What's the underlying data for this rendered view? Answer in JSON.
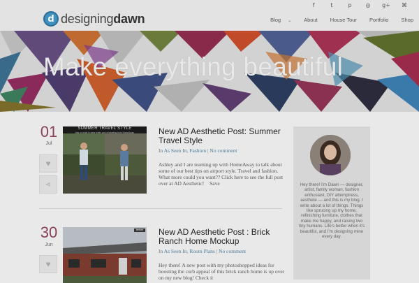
{
  "header": {
    "logo_mark": "d",
    "logo_light": "designing",
    "logo_bold": "dawn",
    "social_icons": [
      "facebook-icon",
      "twitter-icon",
      "pinterest-icon",
      "instagram-icon",
      "google-plus-icon",
      "rss-icon"
    ],
    "social_glyphs": [
      "f",
      "t",
      "p",
      "◎",
      "g+",
      "⌘"
    ],
    "nav": [
      {
        "label": "Blog",
        "has_dropdown": true
      },
      {
        "label": "About"
      },
      {
        "label": "House Tour"
      },
      {
        "label": "Portfolio"
      },
      {
        "label": "Shop"
      }
    ],
    "dropdown_glyph": "⌄"
  },
  "hero": {
    "title": "Make everything beautiful"
  },
  "posts": [
    {
      "day": "01",
      "month": "Jul",
      "thumb_title": "SUMMER TRAVEL STYLE",
      "thumb_subtitle": "tips on what to wear when you're traveling from HomeAway",
      "title": "New AD Aesthetic Post: Summer Travel Style",
      "in": "In",
      "categories": [
        "As Seen In",
        "Fashion"
      ],
      "comments": "No comment",
      "excerpt": "Ashley and I are teaming up with HomeAway to talk about some of our best tips on airport style. Travel and fashion. What more could you want?? Click here to see the full post over at AD Aesthetic!",
      "save": "Save"
    },
    {
      "day": "30",
      "month": "Jun",
      "thumb_title": "before",
      "title": "New AD Aesthetic Post : Brick Ranch Home Mockup",
      "in": "In",
      "categories": [
        "As Seen In",
        "Room Plans"
      ],
      "comments": "No comment",
      "excerpt": "Hey there! A new post with my photoshopped ideas for boosting the curb appeal of this brick ranch home is up over on my new blog! Check it"
    }
  ],
  "sidebar": {
    "bio": "Hey there! I'm Dawn — designer, artist, family woman, fashion enthusiast, DIY attemptress, aesthete — and this is my blog. I write about a lot of things. Things like sprucing up my home, refinishing furniture, clothes that make me happy, and raising two tiny humans. Life's better when it's beautiful, and I'm designing mine every day."
  },
  "colors": {
    "accent": "#8e3f59",
    "link": "#4a7a9a",
    "logo_blue": "#3f8fbf"
  }
}
